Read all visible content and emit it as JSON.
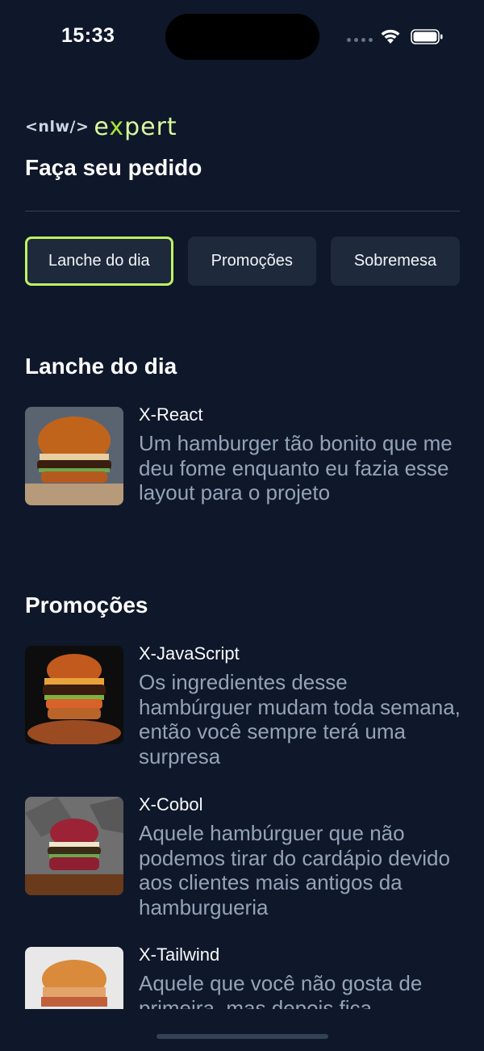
{
  "status_bar": {
    "time": "15:33"
  },
  "header": {
    "logo_tag": "<nlw/>",
    "logo_word_pre": "e",
    "logo_word_x": "x",
    "logo_word_post": "pert",
    "title": "Faça seu pedido"
  },
  "tabs": [
    {
      "label": "Lanche do dia",
      "active": true
    },
    {
      "label": "Promoções",
      "active": false
    },
    {
      "label": "Sobremesa",
      "active": false
    }
  ],
  "sections": [
    {
      "title": "Lanche do dia",
      "products": [
        {
          "name": "X-React",
          "description": "Um hamburger tão bonito que me deu fome enquanto eu fazia esse layout para o projeto"
        }
      ]
    },
    {
      "title": "Promoções",
      "products": [
        {
          "name": "X-JavaScript",
          "description": "Os ingredientes desse hambúrguer mudam toda semana, então você sempre terá uma surpresa"
        },
        {
          "name": "X-Cobol",
          "description": "Aquele hambúrguer que não podemos tirar do cardápio devido aos clientes mais antigos da hamburgueria"
        },
        {
          "name": "X-Tailwind",
          "description": "Aquele que você não gosta de primeira, mas depois fica"
        }
      ]
    }
  ],
  "colors": {
    "background": "#0f172a",
    "card": "#1e293b",
    "accent": "#bef264",
    "muted_text": "#94a3b8"
  },
  "icons": [
    "signal-icon",
    "wifi-icon",
    "battery-icon"
  ]
}
